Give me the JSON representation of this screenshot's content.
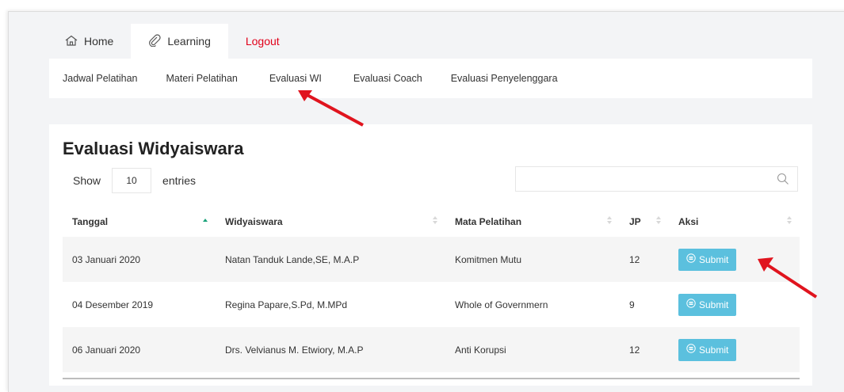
{
  "topnav": {
    "home": "Home",
    "learning": "Learning",
    "logout": "Logout"
  },
  "subnav": [
    "Jadwal Pelatihan",
    "Materi Pelatihan",
    "Evaluasi WI",
    "Evaluasi Coach",
    "Evaluasi Penyelenggara"
  ],
  "page": {
    "title": "Evaluasi Widyaiswara",
    "show_label": "Show",
    "entries_value": "10",
    "entries_label": "entries"
  },
  "table": {
    "headers": [
      "Tanggal",
      "Widyaiswara",
      "Mata Pelatihan",
      "JP",
      "Aksi"
    ],
    "rows": [
      {
        "tanggal": "03 Januari 2020",
        "widyaiswara": "Natan Tanduk Lande,SE, M.A.P",
        "mata_pelatihan": "Komitmen Mutu",
        "jp": "12",
        "aksi": "Submit"
      },
      {
        "tanggal": "04 Desember 2019",
        "widyaiswara": "Regina Papare,S.Pd, M.MPd",
        "mata_pelatihan": "Whole of Governmern",
        "jp": "9",
        "aksi": "Submit"
      },
      {
        "tanggal": "06 Januari 2020",
        "widyaiswara": "Drs. Velvianus M. Etwiory, M.A.P",
        "mata_pelatihan": "Anti Korupsi",
        "jp": "12",
        "aksi": "Submit"
      }
    ]
  },
  "colors": {
    "accent_button": "#5bc0de",
    "logout_red": "#e1001a",
    "annotation_arrow": "#e0141e",
    "sort_active": "#1aa37a"
  }
}
